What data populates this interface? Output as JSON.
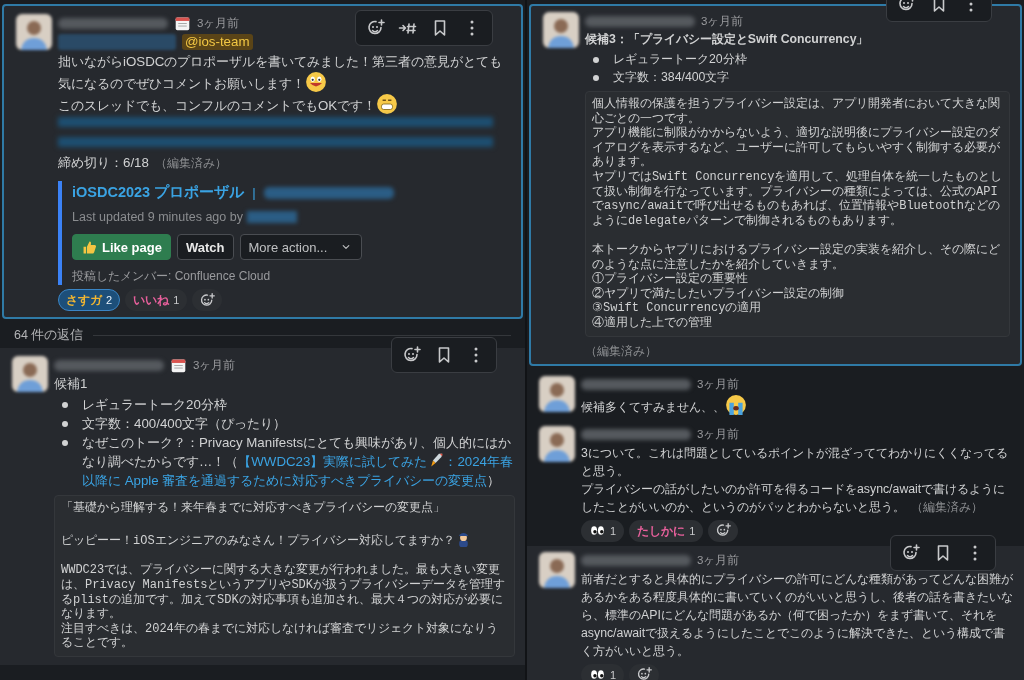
{
  "columns": [
    {
      "items": [
        {
          "kind": "message",
          "highlighted": true,
          "hovered": true,
          "toolbar": {
            "kind": "thread"
          },
          "status": {
            "kind": "calendar"
          },
          "time": "3ヶ月前",
          "blocks": [
            {
              "kind": "mentions",
              "items": [
                {
                  "redacted": true
                },
                {
                  "redacted": false,
                  "text": "@ios-team"
                }
              ]
            },
            {
              "kind": "text",
              "lines": [
                {
                  "text": "拙いながらiOSDCのプロポーザルを書いてみました！第三者の意見がとても気になるのでぜひコメントお願いします！",
                  "emoji": {
                    "kind": "smile"
                  }
                },
                {
                  "text": "このスレッドでも、コンフルのコメントでもOKです！",
                  "emoji": {
                    "kind": "grimace"
                  }
                }
              ]
            },
            {
              "kind": "redacted_link"
            },
            {
              "kind": "text",
              "lines": [
                {
                  "text": "締め切り：6/18",
                  "edited": "（編集済み）"
                }
              ]
            },
            {
              "kind": "attachment",
              "title": "iOSDC2023 プロポーザル",
              "separator": "|",
              "updated": "Last updated 9 minutes ago by",
              "buttons": [
                {
                  "label": "Like page",
                  "kind": "primary"
                },
                {
                  "label": "Watch",
                  "kind": "plain"
                },
                {
                  "label": "More action...",
                  "kind": "select"
                }
              ],
              "footer": "投稿したメンバー: Confluence Cloud"
            }
          ],
          "reactions": [
            {
              "kind": "custom",
              "label": "さすガ",
              "color": "#f2b632",
              "count": "2",
              "selected": true
            },
            {
              "kind": "custom",
              "label": "いいね",
              "color": "#e8609c",
              "count": "1",
              "selected": false
            }
          ]
        },
        {
          "kind": "divider",
          "text": "64 件の返信"
        },
        {
          "kind": "message",
          "highlighted": false,
          "hovered": true,
          "toolbar": {
            "kind": "basic"
          },
          "status": {
            "kind": "calendar"
          },
          "time": "3ヶ月前",
          "blocks": [
            {
              "kind": "text",
              "lines": [
                {
                  "text": "候補1"
                }
              ]
            },
            {
              "kind": "bullets",
              "items": [
                {
                  "text": "レギュラートーク20分枠"
                },
                {
                  "text": "文字数：400/400文字（ぴったり）"
                },
                {
                  "text": "なぜこのトーク？：Privacy Manifestsにとても興味があり、個人的にはかなり調べたからです…！（",
                  "link": "【WWDC23】実際に試してみた",
                  "link_emoji": {
                    "kind": "rocket"
                  },
                  "link_rest": "：2024年春",
                  "link_continued": "以降に Apple 審査を通過するために対応すべきプライバシーの変更点",
                  "tail": "）"
                }
              ]
            },
            {
              "kind": "quote",
              "groups": [
                [
                  {
                    "text": "「基礎から理解する！来年春までに対応すべきプライバシーの変更点」"
                  }
                ],
                [
                  {
                    "text": "ピッピーー！iOSエンジニアのみなさん！プライバシー対応してますか？",
                    "emoji": {
                      "kind": "police"
                    }
                  }
                ],
                [
                  {
                    "text": "WWDC23では、プライバシーに関する大きな変更が行われました。最も大きい変更は、Privacy ManifestsというアプリやSDKが扱うプライバシーデータを管理するplistの追加です。加えてSDKの対応事項も追加され、最大４つの対応が必要になります。"
                  },
                  {
                    "text": "注目すべきは、2024年の春までに対応しなければ審査でリジェクト対象になりうることです。"
                  }
                ]
              ]
            }
          ]
        }
      ]
    },
    {
      "items": [
        {
          "kind": "message",
          "highlighted": true,
          "hovered": true,
          "toolbar": {
            "kind": "basic"
          },
          "time": "3ヶ月前",
          "blocks": [
            {
              "kind": "text",
              "lines": [
                {
                  "text": "候補3：「プライバシー設定とSwift Concurrency」",
                  "bold": true
                }
              ]
            },
            {
              "kind": "bullets",
              "items": [
                {
                  "text": "レギュラートーク20分枠"
                },
                {
                  "text": "文字数：384/400文字"
                }
              ]
            },
            {
              "kind": "quote",
              "groups": [
                [
                  {
                    "text": "個人情報の保護を担うプライバシー設定は、アプリ開発者において大きな関心ごとの一つです。"
                  },
                  {
                    "text": "アプリ機能に制限がかからないよう、適切な説明後にプライバシー設定のダイアログを表示するなど、ユーザーに許可してもらいやすく制御する必要があります。"
                  },
                  {
                    "text": "ヤプリではSwift Concurrencyを適用して、処理自体を統一したものとして扱い制御を行なっています。プライバシーの種類によっては、公式のAPIでasync/awaitで呼び出せるものもあれば、位置情報やBluetoothなどのようにdelegateパターンで制御されるものもあります。"
                  }
                ],
                [
                  {
                    "text": "本トークからヤプリにおけるプライバシー設定の実装を紹介し、その際にどのような点に注意したかを紹介していきます。"
                  },
                  {
                    "text": "①プライバシー設定の重要性"
                  },
                  {
                    "text": "②ヤプリで満たしたいプライバシー設定の制御"
                  },
                  {
                    "text": "③Swift Concurrencyの適用"
                  },
                  {
                    "text": "④適用した上での管理"
                  }
                ]
              ]
            },
            {
              "kind": "edited",
              "text": "（編集済み）"
            }
          ]
        },
        {
          "kind": "message",
          "highlighted": false,
          "hovered": false,
          "time": "3ヶ月前",
          "blocks": [
            {
              "kind": "text",
              "lines": [
                {
                  "text": "候補多くてすみません、、",
                  "emoji": {
                    "kind": "sob"
                  }
                }
              ]
            }
          ]
        },
        {
          "kind": "message",
          "highlighted": false,
          "hovered": false,
          "time": "3ヶ月前",
          "blocks": [
            {
              "kind": "text",
              "lines": [
                {
                  "text": "3について。これは問題としているポイントが混ざっててわかりにくくなってると思う。"
                },
                {
                  "text": "プライバシーの話がしたいのか許可を得るコードをasync/awaitで書けるようにしたことがいいのか、というのがパッとわからないと思う。",
                  "edited": "（編集済み）"
                }
              ]
            }
          ],
          "reactions": [
            {
              "kind": "eyes",
              "count": "1",
              "selected": false
            },
            {
              "kind": "custom",
              "label": "たしかに",
              "color": "#e8609c",
              "count": "1",
              "selected": false
            }
          ]
        },
        {
          "kind": "message",
          "highlighted": false,
          "hovered": true,
          "toolbar": {
            "kind": "basic"
          },
          "time": "3ヶ月前",
          "blocks": [
            {
              "kind": "text",
              "lines": [
                {
                  "text": "前者だとすると具体的にプライバシーの許可にどんな種類があってどんな困難があるかをある程度具体的に書いていくのがいいと思うし、後者の話を書きたいなら、標準のAPIにどんな問題があるか（何で困ったか）をまず書いて、それをasync/awaitで扱えるようにしたことでこのように解決できた、という構成で書く方がいいと思う。"
                }
              ]
            }
          ],
          "reactions": [
            {
              "kind": "eyes",
              "count": "1",
              "selected": false
            }
          ]
        }
      ]
    }
  ]
}
